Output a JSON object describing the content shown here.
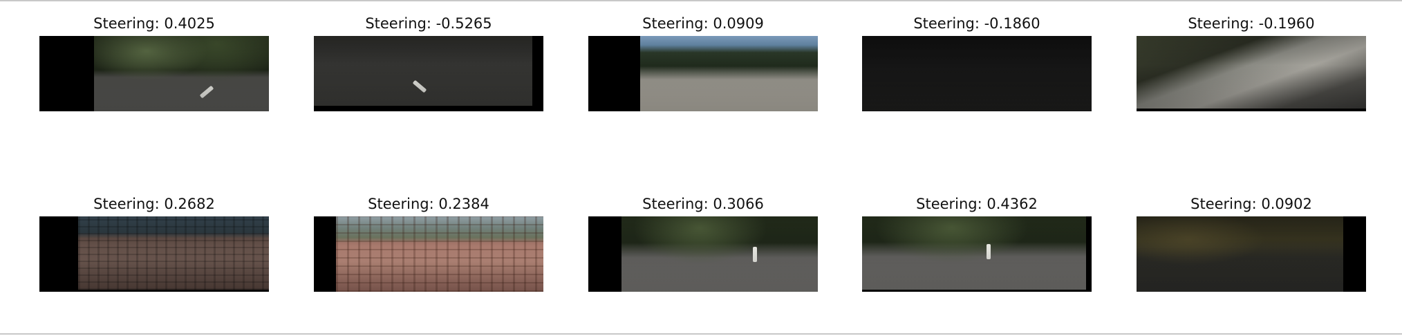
{
  "panels": [
    {
      "title": "Steering: 0.4025"
    },
    {
      "title": "Steering: -0.5265"
    },
    {
      "title": "Steering: 0.0909"
    },
    {
      "title": "Steering: -0.1860"
    },
    {
      "title": "Steering: -0.1960"
    },
    {
      "title": "Steering: 0.2682"
    },
    {
      "title": "Steering: 0.2384"
    },
    {
      "title": "Steering: 0.3066"
    },
    {
      "title": "Steering: 0.4362"
    },
    {
      "title": "Steering: 0.0902"
    }
  ]
}
